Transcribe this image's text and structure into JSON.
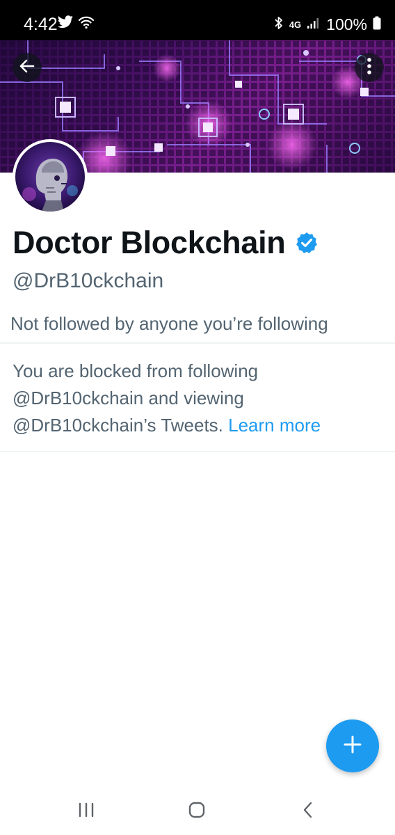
{
  "status_bar": {
    "time": "4:42",
    "network": "4G",
    "battery": "100%",
    "icons": [
      "twitter-icon",
      "wifi-icon",
      "bluetooth-icon",
      "network-4g-icon",
      "signal-icon",
      "battery-icon"
    ]
  },
  "header": {
    "back_icon": "arrow-left-icon",
    "more_icon": "more-vertical-icon"
  },
  "profile": {
    "display_name": "Doctor Blockchain",
    "verified_icon": "verified-badge-icon",
    "handle": "@DrB10ckchain",
    "followers_note": "Not followed by anyone you’re following"
  },
  "blocked_notice": {
    "line1": "You are blocked from following",
    "line2": "@DrB10ckchain and viewing",
    "line3_prefix": "@DrB10ckchain’s Tweets. ",
    "learn_more": "Learn more"
  },
  "fab": {
    "icon": "plus-icon"
  },
  "android_nav": {
    "icons": [
      "recents-icon",
      "home-icon",
      "back-icon"
    ]
  },
  "colors": {
    "accent": "#1d9bf0",
    "text_primary": "#0f1419",
    "text_secondary": "#536471",
    "divider": "#eff3f4",
    "banner_purple": "#7a1e8e"
  }
}
